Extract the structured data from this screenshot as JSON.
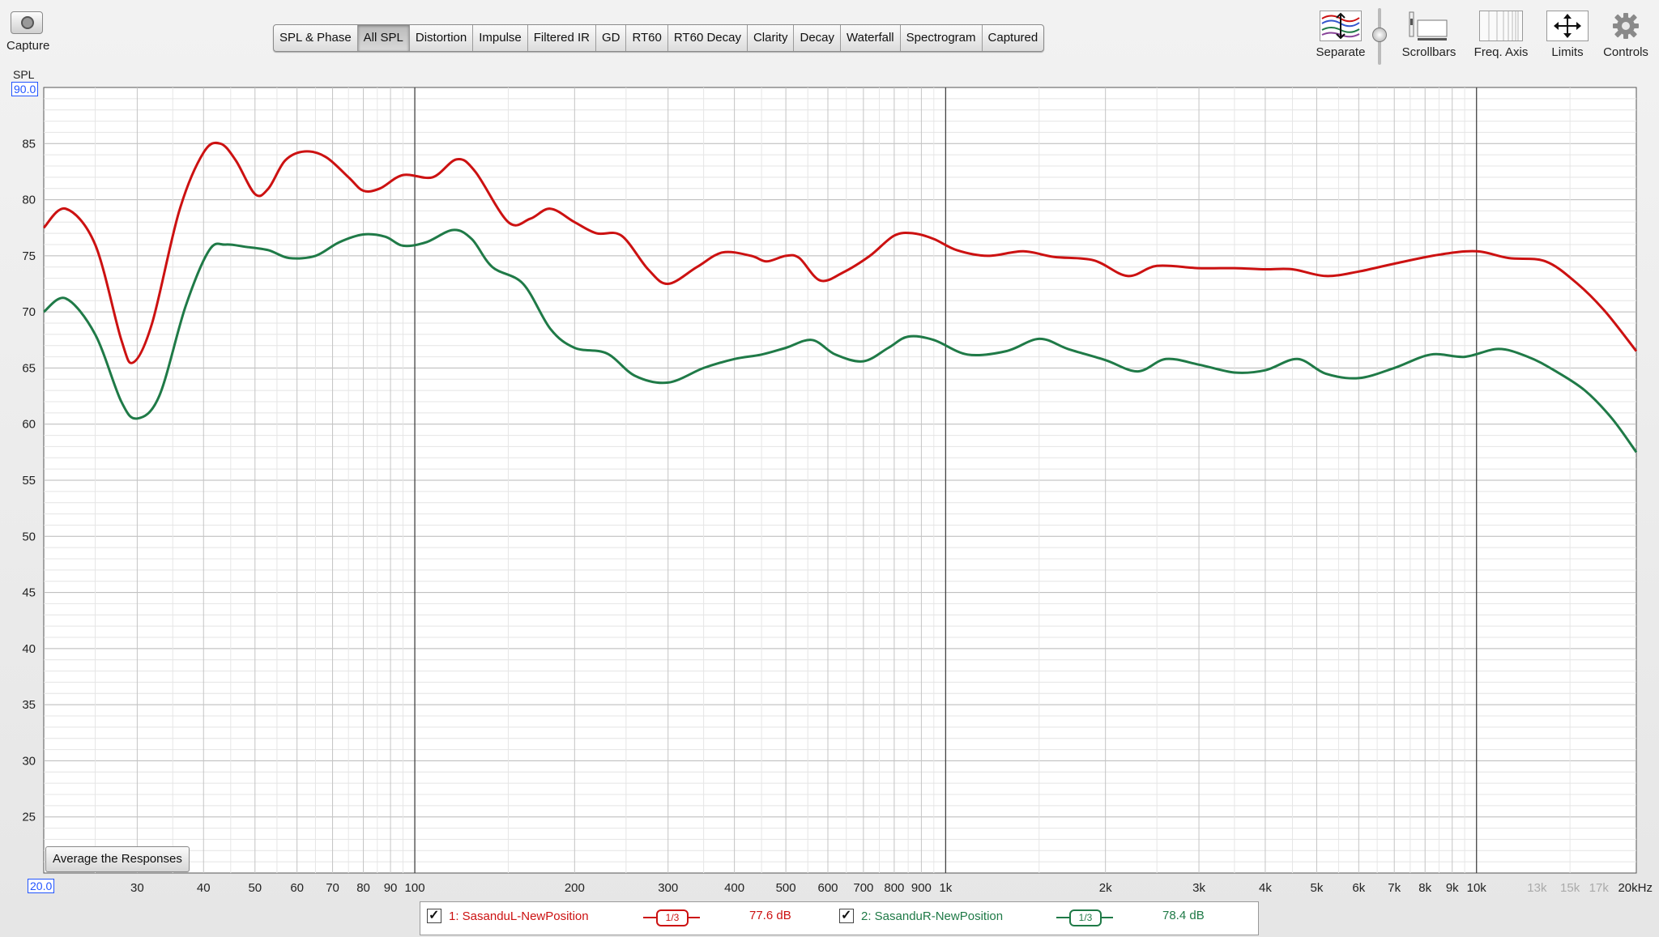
{
  "capture": {
    "label": "Capture"
  },
  "tabs": [
    {
      "label": "SPL & Phase",
      "active": false
    },
    {
      "label": "All SPL",
      "active": true
    },
    {
      "label": "Distortion",
      "active": false
    },
    {
      "label": "Impulse",
      "active": false
    },
    {
      "label": "Filtered IR",
      "active": false
    },
    {
      "label": "GD",
      "active": false
    },
    {
      "label": "RT60",
      "active": false
    },
    {
      "label": "RT60 Decay",
      "active": false
    },
    {
      "label": "Clarity",
      "active": false
    },
    {
      "label": "Decay",
      "active": false
    },
    {
      "label": "Waterfall",
      "active": false
    },
    {
      "label": "Spectrogram",
      "active": false
    },
    {
      "label": "Captured",
      "active": false
    }
  ],
  "toolbar": {
    "separate": "Separate",
    "scrollbars": "Scrollbars",
    "freq_axis": "Freq. Axis",
    "limits": "Limits",
    "controls": "Controls"
  },
  "average_button": "Average the Responses",
  "colors": {
    "red": "#cc1111",
    "green": "#1f7a47",
    "grid": "#d0d0d0",
    "major_grid": "#444444",
    "accent": "#2255ff"
  },
  "chart_data": {
    "type": "line",
    "ylabel": "SPL",
    "ylim": [
      20,
      90
    ],
    "ylim_labels": [
      "90.0",
      "20.0"
    ],
    "y_ticks": [
      85,
      80,
      75,
      70,
      65,
      60,
      55,
      50,
      45,
      40,
      35,
      30,
      25
    ],
    "xlim": [
      20,
      20000
    ],
    "x_scale": "log",
    "x_ticks": [
      {
        "v": 30,
        "t": "30"
      },
      {
        "v": 40,
        "t": "40"
      },
      {
        "v": 50,
        "t": "50"
      },
      {
        "v": 60,
        "t": "60"
      },
      {
        "v": 70,
        "t": "70"
      },
      {
        "v": 80,
        "t": "80"
      },
      {
        "v": 90,
        "t": "90"
      },
      {
        "v": 100,
        "t": "100"
      },
      {
        "v": 200,
        "t": "200"
      },
      {
        "v": 300,
        "t": "300"
      },
      {
        "v": 400,
        "t": "400"
      },
      {
        "v": 500,
        "t": "500"
      },
      {
        "v": 600,
        "t": "600"
      },
      {
        "v": 700,
        "t": "700"
      },
      {
        "v": 800,
        "t": "800"
      },
      {
        "v": 900,
        "t": "900"
      },
      {
        "v": 1000,
        "t": "1k"
      },
      {
        "v": 2000,
        "t": "2k"
      },
      {
        "v": 3000,
        "t": "3k"
      },
      {
        "v": 4000,
        "t": "4k"
      },
      {
        "v": 5000,
        "t": "5k"
      },
      {
        "v": 6000,
        "t": "6k"
      },
      {
        "v": 7000,
        "t": "7k"
      },
      {
        "v": 8000,
        "t": "8k"
      },
      {
        "v": 9000,
        "t": "9k"
      },
      {
        "v": 10000,
        "t": "10k"
      },
      {
        "v": 13000,
        "t": "13k",
        "muted": true
      },
      {
        "v": 15000,
        "t": "15k",
        "muted": true
      },
      {
        "v": 17000,
        "t": "17k",
        "muted": true
      },
      {
        "v": 20000,
        "t": "20kHz"
      }
    ],
    "series": [
      {
        "name": "1: SasanduL-NewPosition",
        "smoothing": "1/3",
        "level": "77.6 dB",
        "color": "#cc1111",
        "points": [
          [
            20,
            77.5
          ],
          [
            22,
            79.2
          ],
          [
            25,
            76
          ],
          [
            28,
            67.5
          ],
          [
            29.5,
            65.5
          ],
          [
            32,
            69
          ],
          [
            36,
            79
          ],
          [
            40,
            84.2
          ],
          [
            43,
            85
          ],
          [
            46,
            83.5
          ],
          [
            50,
            80.5
          ],
          [
            53,
            81
          ],
          [
            57,
            83.5
          ],
          [
            62,
            84.3
          ],
          [
            68,
            83.8
          ],
          [
            75,
            82
          ],
          [
            80,
            80.8
          ],
          [
            86,
            81
          ],
          [
            95,
            82.2
          ],
          [
            108,
            82
          ],
          [
            120,
            83.6
          ],
          [
            130,
            82.5
          ],
          [
            150,
            78
          ],
          [
            165,
            78.3
          ],
          [
            180,
            79.2
          ],
          [
            200,
            78
          ],
          [
            220,
            77
          ],
          [
            245,
            76.8
          ],
          [
            275,
            73.8
          ],
          [
            300,
            72.5
          ],
          [
            340,
            74
          ],
          [
            380,
            75.3
          ],
          [
            430,
            75
          ],
          [
            460,
            74.5
          ],
          [
            500,
            75
          ],
          [
            530,
            74.8
          ],
          [
            580,
            72.8
          ],
          [
            640,
            73.5
          ],
          [
            720,
            75
          ],
          [
            800,
            76.8
          ],
          [
            870,
            77
          ],
          [
            950,
            76.5
          ],
          [
            1050,
            75.5
          ],
          [
            1200,
            75
          ],
          [
            1400,
            75.4
          ],
          [
            1600,
            74.9
          ],
          [
            1900,
            74.6
          ],
          [
            2200,
            73.2
          ],
          [
            2500,
            74.1
          ],
          [
            3000,
            73.9
          ],
          [
            3500,
            73.9
          ],
          [
            4000,
            73.8
          ],
          [
            4500,
            73.8
          ],
          [
            5200,
            73.2
          ],
          [
            6000,
            73.6
          ],
          [
            7000,
            74.3
          ],
          [
            8500,
            75.1
          ],
          [
            10000,
            75.4
          ],
          [
            11500,
            74.8
          ],
          [
            13500,
            74.5
          ],
          [
            15500,
            72.5
          ],
          [
            17500,
            70
          ],
          [
            20000,
            66.5
          ]
        ]
      },
      {
        "name": "2: SasanduR-NewPosition",
        "smoothing": "1/3",
        "level": "78.4 dB",
        "color": "#1f7a47",
        "points": [
          [
            20,
            70
          ],
          [
            22,
            71.2
          ],
          [
            25,
            68
          ],
          [
            28,
            62
          ],
          [
            30,
            60.5
          ],
          [
            33,
            62.5
          ],
          [
            37,
            70.5
          ],
          [
            41,
            75.5
          ],
          [
            44,
            76
          ],
          [
            48,
            75.8
          ],
          [
            53,
            75.5
          ],
          [
            58,
            74.8
          ],
          [
            65,
            75
          ],
          [
            72,
            76.2
          ],
          [
            80,
            76.9
          ],
          [
            88,
            76.7
          ],
          [
            95,
            75.9
          ],
          [
            105,
            76.2
          ],
          [
            118,
            77.3
          ],
          [
            128,
            76.5
          ],
          [
            140,
            74
          ],
          [
            160,
            72.5
          ],
          [
            180,
            68.5
          ],
          [
            200,
            66.8
          ],
          [
            230,
            66.3
          ],
          [
            260,
            64.3
          ],
          [
            300,
            63.7
          ],
          [
            350,
            65
          ],
          [
            400,
            65.8
          ],
          [
            450,
            66.2
          ],
          [
            500,
            66.8
          ],
          [
            560,
            67.5
          ],
          [
            620,
            66.2
          ],
          [
            700,
            65.6
          ],
          [
            780,
            66.8
          ],
          [
            850,
            67.8
          ],
          [
            950,
            67.5
          ],
          [
            1100,
            66.2
          ],
          [
            1300,
            66.5
          ],
          [
            1500,
            67.6
          ],
          [
            1700,
            66.7
          ],
          [
            2000,
            65.7
          ],
          [
            2300,
            64.7
          ],
          [
            2600,
            65.8
          ],
          [
            3000,
            65.3
          ],
          [
            3500,
            64.6
          ],
          [
            4000,
            64.8
          ],
          [
            4600,
            65.8
          ],
          [
            5200,
            64.5
          ],
          [
            6000,
            64.1
          ],
          [
            7000,
            65
          ],
          [
            8200,
            66.2
          ],
          [
            9500,
            66
          ],
          [
            11000,
            66.7
          ],
          [
            12500,
            66
          ],
          [
            14000,
            64.8
          ],
          [
            16000,
            63
          ],
          [
            18000,
            60.5
          ],
          [
            20000,
            57.5
          ]
        ]
      }
    ]
  }
}
